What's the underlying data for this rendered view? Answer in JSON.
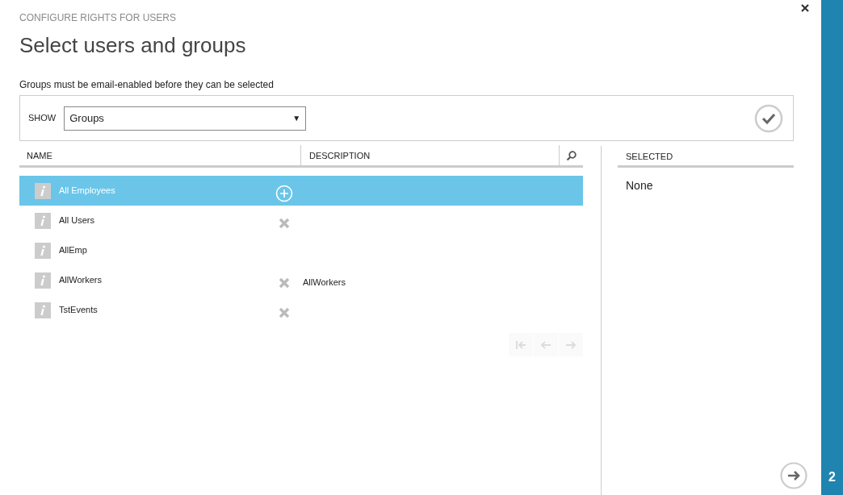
{
  "dialog": {
    "subtitle": "CONFIGURE RIGHTS FOR USERS",
    "title": "Select users and groups",
    "hint": "Groups must be email-enabled before they can be selected"
  },
  "filter": {
    "label": "SHOW",
    "value": "Groups",
    "caret": "▼"
  },
  "table": {
    "columns": [
      "NAME",
      "DESCRIPTION"
    ],
    "rows": [
      {
        "name": "All Employees",
        "kind": "addable",
        "selected": true
      },
      {
        "name": "All Users",
        "kind": "removable",
        "selected": false
      },
      {
        "name": "AllEmp",
        "kind": "plain",
        "selected": false
      },
      {
        "name": "AllWorkers",
        "description": "AllWorkers",
        "kind": "removable",
        "selected": false
      },
      {
        "name": "TstEvents",
        "kind": "removable",
        "selected": false
      }
    ]
  },
  "pager": [
    {
      "kind": "first",
      "disabled": true
    },
    {
      "kind": "prev",
      "disabled": true
    },
    {
      "kind": "next",
      "disabled": true
    }
  ],
  "selected_panel": {
    "heading": "SELECTED",
    "value": "None"
  },
  "wizard": {
    "step": "2"
  }
}
